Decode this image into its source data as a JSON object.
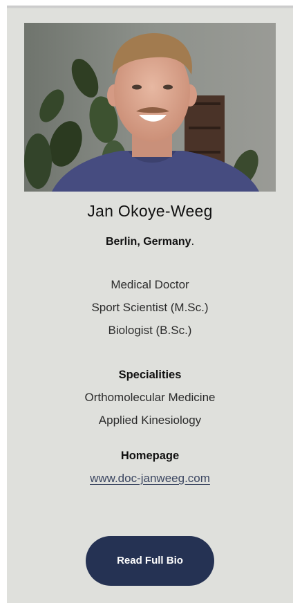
{
  "profile": {
    "name": "Jan Okoye-Weeg",
    "location": "Berlin, Germany",
    "location_suffix": ".",
    "titles": [
      "Medical Doctor",
      "Sport Scientist (M.Sc.)",
      "Biologist (B.Sc.)"
    ]
  },
  "specialities": {
    "heading": "Specialities",
    "items": [
      "Orthomolecular Medicine",
      "Applied Kinesiology"
    ]
  },
  "homepage": {
    "heading": "Homepage",
    "url_text": "www.doc-janweeg.com"
  },
  "cta": {
    "label": "Read Full Bio"
  },
  "colors": {
    "card_background": "#dfe0dc",
    "button_background": "#253253",
    "link": "#3a4560"
  }
}
